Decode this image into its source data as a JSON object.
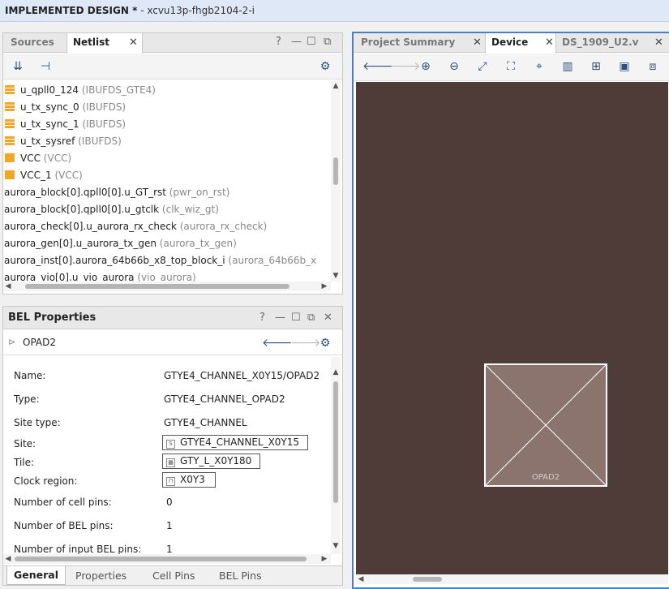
{
  "titlebar": {
    "title": "IMPLEMENTED DESIGN *",
    "subtitle": "- xcvu13p-fhgb2104-2-i"
  },
  "left_top": {
    "tabs": [
      "Sources",
      "Netlist"
    ],
    "window_controls": [
      "?",
      "—",
      "☐",
      "⧉"
    ],
    "netlist_rows": [
      {
        "name": "u_qpll0_124",
        "cell": "(IBUFDS_GTE4)",
        "icon": "lines"
      },
      {
        "name": "u_tx_sync_0",
        "cell": "(IBUFDS)",
        "icon": "lines"
      },
      {
        "name": "u_tx_sync_1",
        "cell": "(IBUFDS)",
        "icon": "lines"
      },
      {
        "name": "u_tx_sysref",
        "cell": "(IBUFDS)",
        "icon": "lines"
      },
      {
        "name": "VCC",
        "cell": "(VCC)",
        "icon": "solid"
      },
      {
        "name": "VCC_1",
        "cell": "(VCC)",
        "icon": "solid"
      },
      {
        "name": "aurora_block[0].qpll0[0].u_GT_rst",
        "cell": "(pwr_on_rst)",
        "icon": "none"
      },
      {
        "name": "aurora_block[0].qpll0[0].u_gtclk",
        "cell": "(clk_wiz_gt)",
        "icon": "none"
      },
      {
        "name": "aurora_check[0].u_aurora_rx_check",
        "cell": "(aurora_rx_check)",
        "icon": "none"
      },
      {
        "name": "aurora_gen[0].u_aurora_tx_gen",
        "cell": "(aurora_tx_gen)",
        "icon": "none"
      },
      {
        "name": "aurora_inst[0].aurora_64b66b_x8_top_block_i",
        "cell": "(aurora_64b66b_x",
        "icon": "none"
      },
      {
        "name": "aurora_vio[0].u_vio_aurora",
        "cell": "(vio_aurora)",
        "icon": "none"
      }
    ]
  },
  "bel": {
    "title": "BEL Properties",
    "object": "OPAD2",
    "props": [
      {
        "label": "Name:",
        "value": "GTYE4_CHANNEL_X0Y15/OPAD2",
        "boxed": false
      },
      {
        "label": "Type:",
        "value": "GTYE4_CHANNEL_OPAD2",
        "boxed": false
      },
      {
        "label": "Site type:",
        "value": "GTYE4_CHANNEL",
        "boxed": false
      },
      {
        "label": "Site:",
        "value": "GTYE4_CHANNEL_X0Y15",
        "boxed": true,
        "icon": "S"
      },
      {
        "label": "Tile:",
        "value": "GTY_L_X0Y180",
        "boxed": true,
        "icon": "▦"
      },
      {
        "label": "Clock region:",
        "value": "X0Y3",
        "boxed": true,
        "icon": "⊓"
      },
      {
        "label": "Number of cell pins:",
        "value": "0",
        "boxed": false
      },
      {
        "label": "Number of BEL pins:",
        "value": "1",
        "boxed": false
      },
      {
        "label": "Number of input BEL pins:",
        "value": "1",
        "boxed": false
      }
    ],
    "bottom_tabs": [
      "General",
      "Properties",
      "Cell Pins",
      "BEL Pins"
    ]
  },
  "right": {
    "tabs": [
      "Project Summary",
      "Device",
      "DS_1909_U2.v"
    ],
    "site_label": "OPAD2"
  },
  "colors": {
    "device_bg": "#4f3b37",
    "site_fill": "#8a746d",
    "netlist_icon": "#f5a623"
  }
}
